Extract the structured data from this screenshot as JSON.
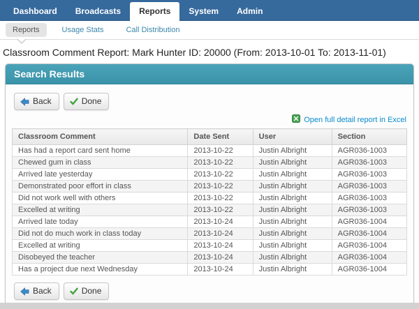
{
  "colors": {
    "nav_bg": "#36699c",
    "panel_header_teal": "#3f96ac",
    "subnav_link_blue": "#3a87ad",
    "excel_link_blue": "#0a8cce",
    "back_arrow_blue": "#3c8ac8",
    "done_check_green": "#47a33f",
    "excel_icon_green": "#48a355"
  },
  "nav": {
    "tabs": [
      {
        "label": "Dashboard",
        "active": false
      },
      {
        "label": "Broadcasts",
        "active": false
      },
      {
        "label": "Reports",
        "active": true
      },
      {
        "label": "System",
        "active": false
      },
      {
        "label": "Admin",
        "active": false
      }
    ]
  },
  "subnav": {
    "items": [
      {
        "label": "Reports",
        "active": true
      },
      {
        "label": "Usage Stats",
        "active": false
      },
      {
        "label": "Call Distribution",
        "active": false
      }
    ]
  },
  "page_title": "Classroom Comment Report: Mark Hunter ID: 20000 (From: 2013-10-01 To: 2013-11-01)",
  "panel": {
    "title": "Search Results"
  },
  "buttons": {
    "back": "Back",
    "done": "Done"
  },
  "excel_link": {
    "label": "Open full detail report in Excel",
    "icon": "excel-icon"
  },
  "icons": {
    "back_button": "arrow-left-icon",
    "done_button": "check-icon",
    "excel_link": "excel-icon",
    "subnav_active": "caret-down-pointer"
  },
  "table": {
    "columns": [
      "Classroom Comment",
      "Date Sent",
      "User",
      "Section"
    ],
    "rows": [
      [
        "Has had a report card sent home",
        "2013-10-22",
        "Justin Albright",
        "AGR036-1003"
      ],
      [
        "Chewed gum in class",
        "2013-10-22",
        "Justin Albright",
        "AGR036-1003"
      ],
      [
        "Arrived late yesterday",
        "2013-10-22",
        "Justin Albright",
        "AGR036-1003"
      ],
      [
        "Demonstrated poor effort in class",
        "2013-10-22",
        "Justin Albright",
        "AGR036-1003"
      ],
      [
        "Did not work well with others",
        "2013-10-22",
        "Justin Albright",
        "AGR036-1003"
      ],
      [
        "Excelled at writing",
        "2013-10-22",
        "Justin Albright",
        "AGR036-1003"
      ],
      [
        "Arrived late today",
        "2013-10-24",
        "Justin Albright",
        "AGR036-1004"
      ],
      [
        "Did not do much work in class today",
        "2013-10-24",
        "Justin Albright",
        "AGR036-1004"
      ],
      [
        "Excelled at writing",
        "2013-10-24",
        "Justin Albright",
        "AGR036-1004"
      ],
      [
        "Disobeyed the teacher",
        "2013-10-24",
        "Justin Albright",
        "AGR036-1004"
      ],
      [
        "Has a project due next Wednesday",
        "2013-10-24",
        "Justin Albright",
        "AGR036-1004"
      ]
    ]
  }
}
